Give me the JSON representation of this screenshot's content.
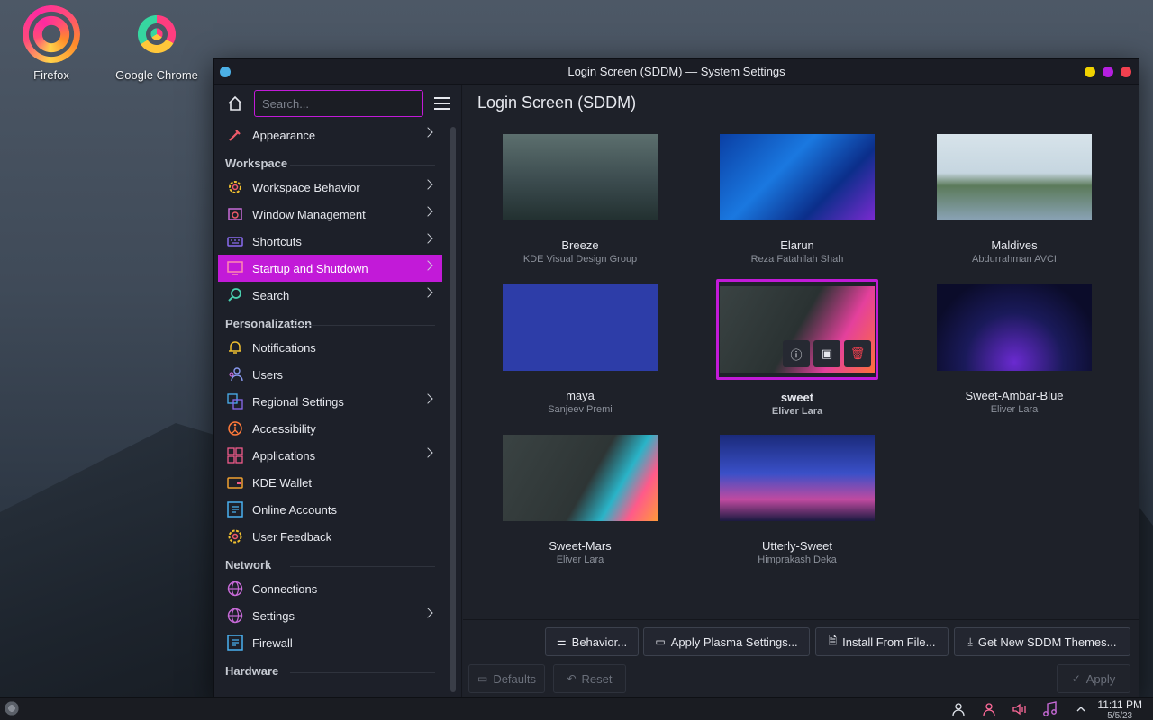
{
  "desktop": {
    "icons": [
      {
        "label": "Firefox"
      },
      {
        "label": "Google Chrome"
      }
    ]
  },
  "window": {
    "title": "Login Screen (SDDM) — System Settings"
  },
  "sidebar": {
    "search_placeholder": "Search...",
    "items": [
      {
        "label": "Appearance"
      },
      {
        "section": "Workspace"
      },
      {
        "label": "Workspace Behavior"
      },
      {
        "label": "Window Management"
      },
      {
        "label": "Shortcuts"
      },
      {
        "label": "Startup and Shutdown"
      },
      {
        "label": "Search"
      },
      {
        "section": "Personalization"
      },
      {
        "label": "Notifications"
      },
      {
        "label": "Users"
      },
      {
        "label": "Regional Settings"
      },
      {
        "label": "Accessibility"
      },
      {
        "label": "Applications"
      },
      {
        "label": "KDE Wallet"
      },
      {
        "label": "Online Accounts"
      },
      {
        "label": "User Feedback"
      },
      {
        "section": "Network"
      },
      {
        "label": "Connections"
      },
      {
        "label": "Settings"
      },
      {
        "label": "Firewall"
      },
      {
        "section": "Hardware"
      }
    ]
  },
  "main": {
    "title": "Login Screen (SDDM)",
    "themes": [
      {
        "name": "Breeze",
        "author": "KDE Visual Design Group"
      },
      {
        "name": "Elarun",
        "author": "Reza Fatahilah Shah"
      },
      {
        "name": "Maldives",
        "author": "Abdurrahman AVCI"
      },
      {
        "name": "maya",
        "author": "Sanjeev Premi"
      },
      {
        "name": "sweet",
        "author": "Eliver Lara"
      },
      {
        "name": "Sweet-Ambar-Blue",
        "author": "Eliver Lara"
      },
      {
        "name": "Sweet-Mars",
        "author": "Eliver Lara"
      },
      {
        "name": "Utterly-Sweet",
        "author": "Himprakash Deka"
      }
    ],
    "selected_theme": "sweet"
  },
  "footer": {
    "behavior": "Behavior...",
    "apply_plasma": "Apply Plasma Settings...",
    "install_file": "Install From File...",
    "get_new": "Get New SDDM Themes...",
    "defaults": "Defaults",
    "reset": "Reset",
    "apply": "Apply"
  },
  "taskbar": {
    "time": "11:11 PM",
    "date": "5/5/23"
  },
  "colors": {
    "accent": "#c21ad8",
    "window_bg": "#1d2029"
  }
}
